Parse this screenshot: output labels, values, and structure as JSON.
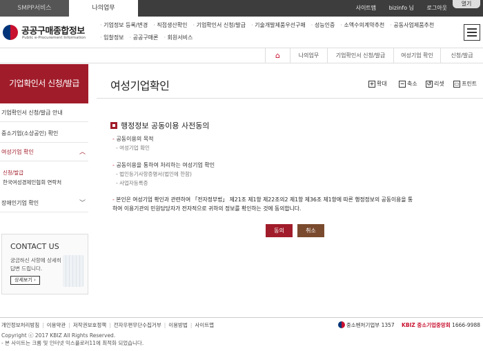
{
  "topbar": {
    "tabs": [
      "SMPP서비스",
      "나의업무"
    ],
    "links": [
      "사이트맵",
      "bizinfo 님",
      "로그아웃"
    ],
    "toggle_label": "열기"
  },
  "header": {
    "logo_title": "공공구매종합정보",
    "logo_sub": "Public e-Procurement Information",
    "gnb_row1": [
      "기업정보 등록/변경",
      "직접생산확인",
      "기업확인서 신청/발급",
      "기술개발제품우선구매",
      "성능인증",
      "소액수의계약추천",
      "공동사업제품추천"
    ],
    "gnb_row2": [
      "입찰정보",
      "공공구매론",
      "회원서비스"
    ]
  },
  "breadcrumb": {
    "home_icon": "home-icon",
    "items": [
      "나의업무",
      "기업확인서 신청/발급",
      "여성기업 확인",
      "신청/발급"
    ]
  },
  "sidebar": {
    "heading": "기업확인서 신청/발급",
    "items": [
      "기업확인서 신청/발급 안내",
      "중소기업(소상공인) 확인",
      "여성기업 확인",
      "장애인기업 확인"
    ],
    "sub_items": [
      "신청/발급",
      "한국여성경제인협회 연락처"
    ],
    "contact": {
      "title": "CONTACT US",
      "desc": "궁금하신 사항에 상세히 답변 드립니다.",
      "button": "상세보기"
    }
  },
  "main": {
    "title": "여성기업확인",
    "tools": [
      "확대",
      "축소",
      "리셋",
      "프린트"
    ],
    "section_title": "행정정보 공동이용 사전동의",
    "block1_head": "공동이용의 목적",
    "block1_lines": [
      "- 여성기업 확인"
    ],
    "block2_head": "공동이용을 통하여 처리하는 여성기업 확인",
    "block2_lines": [
      "- 법인등기사항증명서(법인에 한함)",
      "- 사업자등록증"
    ],
    "consent": "본인은 여성기업 확인과 관련하여 「전자정부법」 제21조 제1항 제22조의2 제1항 제36조 제1항에 따른 행정정보의 공동이용을 통하여 이용기관의 민원담당자가 전자적으로 귀하의 정보를 확인하는 것에 동의합니다.",
    "agree_button": "동의",
    "cancel_button": "취소"
  },
  "footer": {
    "links": [
      "개인정보처리방침",
      "이용약관",
      "저작권보호정책",
      "전자우편무단수집거부",
      "이용방법",
      "사이트맵"
    ],
    "copyright": "Copyright ⓒ 2017 KBIZ All Rights Reserved.",
    "notice": "- 본 사이트는 크롬 및 인터넷 익스플로러11에 최적화 되었습니다.",
    "right_org1": "중소벤처기업부",
    "right_phone1": "1357",
    "right_org2": "KBIZ 중소기업중앙회",
    "right_phone2": "1666-9988"
  },
  "colors": {
    "accent": "#a11c2a",
    "cancel": "#7a4a2e",
    "topbar": "#3d3d3d"
  }
}
